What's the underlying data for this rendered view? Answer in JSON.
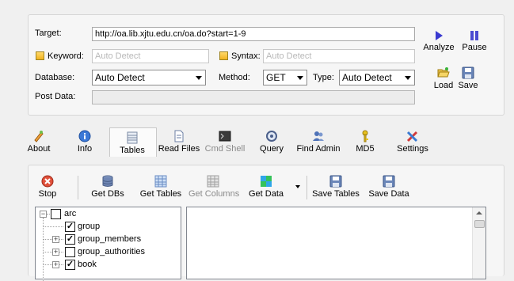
{
  "form": {
    "target_label": "Target:",
    "target_value": "http://oa.lib.xjtu.edu.cn/oa.do?start=1-9",
    "keyword_label": "Keyword:",
    "keyword_placeholder": "Auto Detect",
    "syntax_label": "Syntax:",
    "syntax_placeholder": "Auto Detect",
    "database_label": "Database:",
    "database_value": "Auto Detect",
    "method_label": "Method:",
    "method_value": "GET",
    "type_label": "Type:",
    "type_value": "Auto Detect",
    "postdata_label": "Post Data:",
    "postdata_value": ""
  },
  "side_actions": {
    "analyze": "Analyze",
    "pause": "Pause",
    "load": "Load",
    "save": "Save"
  },
  "tabs": [
    "About",
    "Info",
    "Tables",
    "Read Files",
    "Cmd Shell",
    "Query",
    "Find Admin",
    "MD5",
    "Settings"
  ],
  "active_tab": "Tables",
  "toolbar": {
    "stop": "Stop",
    "get_dbs": "Get DBs",
    "get_tables": "Get Tables",
    "get_columns": "Get Columns",
    "get_data": "Get Data",
    "save_tables": "Save Tables",
    "save_data": "Save Data"
  },
  "tree": {
    "root": "arc",
    "items": [
      {
        "label": "group",
        "checked": true,
        "expandable": false
      },
      {
        "label": "group_members",
        "checked": true,
        "expandable": true
      },
      {
        "label": "group_authorities",
        "checked": false,
        "expandable": true
      },
      {
        "label": "book",
        "checked": true,
        "expandable": true
      }
    ]
  },
  "colors": {
    "accent_checkbox": "#f2b320",
    "play_blue": "#3a3ad0"
  }
}
